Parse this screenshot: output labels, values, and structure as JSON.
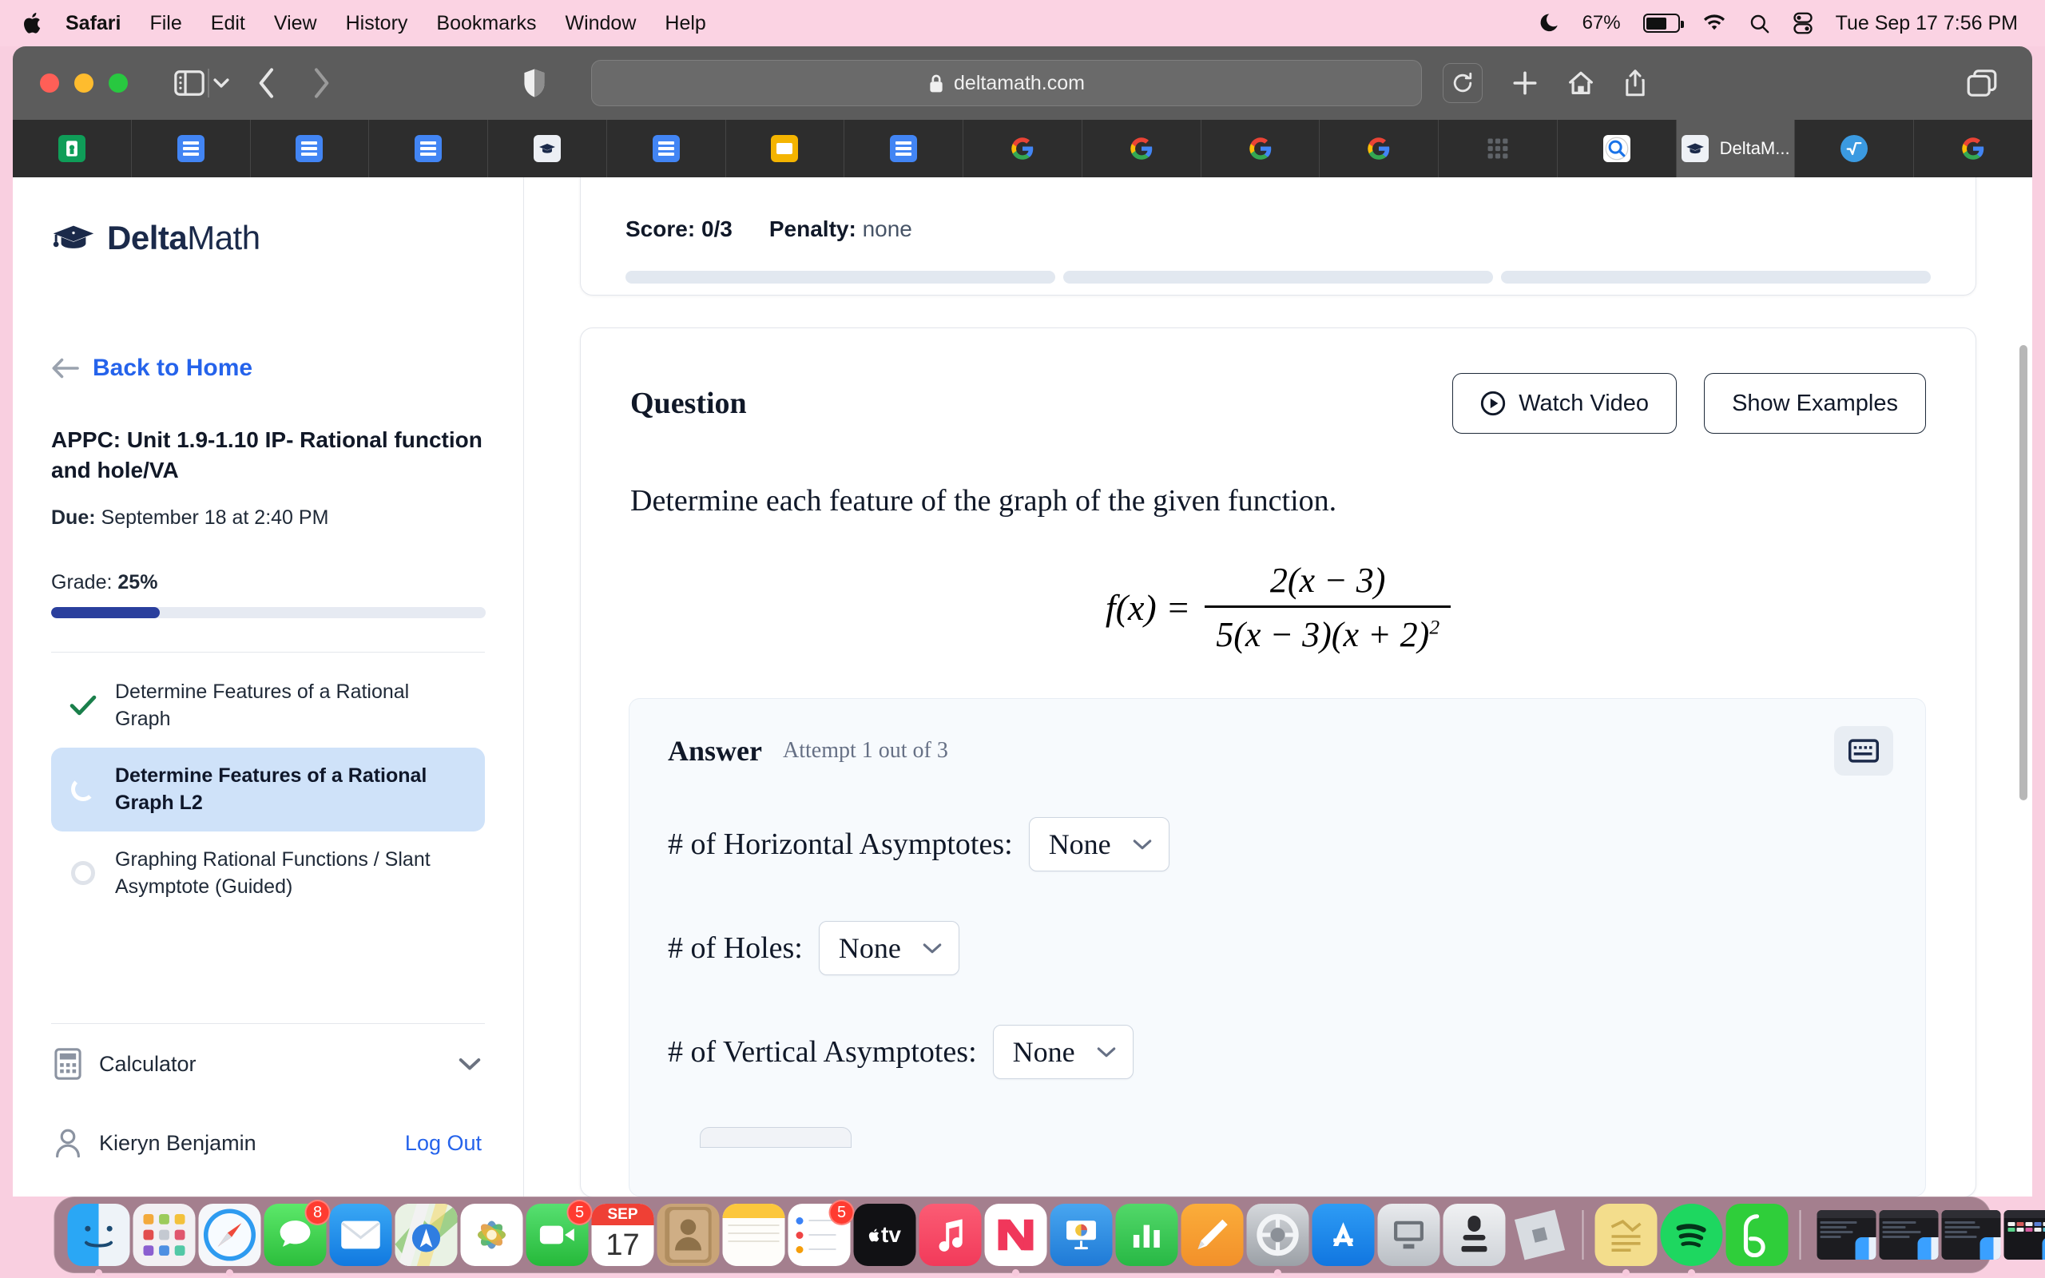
{
  "menubar": {
    "apple_icon": "apple-logo",
    "items": [
      {
        "label": "Safari",
        "bold": true
      },
      {
        "label": "File",
        "bold": false
      },
      {
        "label": "Edit",
        "bold": false
      },
      {
        "label": "View",
        "bold": false
      },
      {
        "label": "History",
        "bold": false
      },
      {
        "label": "Bookmarks",
        "bold": false
      },
      {
        "label": "Window",
        "bold": false
      },
      {
        "label": "Help",
        "bold": false
      }
    ],
    "status": {
      "focus_icon": "moon-icon",
      "battery_percent": "67%",
      "battery_level": 67,
      "wifi_icon": "wifi-icon",
      "search_icon": "search-icon",
      "control_center_icon": "control-center-icon",
      "datetime": "Tue Sep 17  7:56 PM"
    }
  },
  "browser": {
    "traffic_lights": [
      "close",
      "minimize",
      "zoom"
    ],
    "sidebar_icon": "sidebar-toggle-icon",
    "sidebar_chevron_icon": "chevron-down-icon",
    "back_icon": "chevron-left-icon",
    "forward_icon": "chevron-right-icon",
    "shield_icon": "privacy-shield-icon",
    "address": {
      "lock_icon": "lock-icon",
      "url": "deltamath.com"
    },
    "reload_icon": "reload-icon",
    "new_tab_icon": "plus-icon",
    "home_icon": "home-icon",
    "share_icon": "share-icon",
    "tab_overview_icon": "tab-overview-icon",
    "tabs": [
      {
        "favicon": "green-app-icon",
        "title": "",
        "active": false
      },
      {
        "favicon": "google-docs-icon",
        "title": "",
        "active": false
      },
      {
        "favicon": "google-docs-icon",
        "title": "",
        "active": false
      },
      {
        "favicon": "google-docs-icon",
        "title": "",
        "active": false
      },
      {
        "favicon": "deltamath-icon",
        "title": "",
        "active": false
      },
      {
        "favicon": "google-docs-icon",
        "title": "",
        "active": false
      },
      {
        "favicon": "google-slides-icon",
        "title": "",
        "active": false
      },
      {
        "favicon": "google-docs-icon",
        "title": "",
        "active": false
      },
      {
        "favicon": "google-icon",
        "title": "",
        "active": false
      },
      {
        "favicon": "google-icon",
        "title": "",
        "active": false
      },
      {
        "favicon": "google-icon",
        "title": "",
        "active": false
      },
      {
        "favicon": "google-icon",
        "title": "",
        "active": false
      },
      {
        "favicon": "google-apps-grid-icon",
        "title": "",
        "active": false
      },
      {
        "favicon": "search-circle-icon",
        "title": "",
        "active": false
      },
      {
        "favicon": "deltamath-icon",
        "title": "DeltaM...",
        "active": true
      },
      {
        "favicon": "radical-icon",
        "title": "",
        "active": false
      },
      {
        "favicon": "google-icon",
        "title": "",
        "active": false
      }
    ]
  },
  "sidebar": {
    "logo_text_bold": "Delta",
    "logo_text_light": "Math",
    "logo_icon": "graduation-cap-icon",
    "back_arrow_icon": "arrow-left-icon",
    "back_label": "Back to Home",
    "assignment_title": "APPC: Unit 1.9-1.10 IP- Rational function and hole/VA",
    "due_label": "Due:",
    "due_value": "September 18 at 2:40 PM",
    "grade_label": "Grade:",
    "grade_value": "25%",
    "grade_percent": 25,
    "problems": [
      {
        "label": "Determine Features of a Rational Graph",
        "status": "complete",
        "status_icon": "check-icon",
        "current": false
      },
      {
        "label": "Determine Features of a Rational Graph L2",
        "status": "in-progress",
        "status_icon": "partial-ring-icon",
        "current": true
      },
      {
        "label": "Graphing Rational Functions / Slant Asymptote (Guided)",
        "status": "not-started",
        "status_icon": "empty-ring-icon",
        "current": false
      }
    ],
    "calculator_label": "Calculator",
    "calculator_icon": "calculator-icon",
    "calculator_chevron_icon": "chevron-down-icon",
    "user_name": "Kieryn Benjamin",
    "user_icon": "person-icon",
    "logout_label": "Log Out"
  },
  "main": {
    "score_label": "Score:",
    "score_value": "0/3",
    "penalty_label": "Penalty:",
    "penalty_value": "none",
    "progress_segments": 3,
    "question_title": "Question",
    "watch_video_label": "Watch Video",
    "watch_video_icon": "play-circle-icon",
    "show_examples_label": "Show Examples",
    "prompt": "Determine each feature of the graph of the given function.",
    "formula": {
      "lhs": "f(x) =",
      "numerator": "2(x − 3)",
      "denominator_base": "5(x − 3)(x + 2)",
      "denominator_exp": "2"
    },
    "answer": {
      "title": "Answer",
      "attempt": "Attempt 1 out of 3",
      "keyboard_icon": "keyboard-icon",
      "fields": [
        {
          "label": "# of Horizontal Asymptotes:",
          "value": "None",
          "chevron_icon": "chevron-down-icon"
        },
        {
          "label": "# of Holes:",
          "value": "None",
          "chevron_icon": "chevron-down-icon"
        },
        {
          "label": "# of Vertical Asymptotes:",
          "value": "None",
          "chevron_icon": "chevron-down-icon"
        }
      ]
    }
  },
  "dock": {
    "items": [
      {
        "name": "finder",
        "running": true,
        "badge": ""
      },
      {
        "name": "launchpad",
        "running": false,
        "badge": ""
      },
      {
        "name": "safari",
        "running": true,
        "badge": ""
      },
      {
        "name": "messages",
        "running": false,
        "badge": "8"
      },
      {
        "name": "mail",
        "running": false,
        "badge": ""
      },
      {
        "name": "maps",
        "running": false,
        "badge": ""
      },
      {
        "name": "photos",
        "running": false,
        "badge": ""
      },
      {
        "name": "facetime",
        "running": false,
        "badge": "5"
      },
      {
        "name": "calendar",
        "running": false,
        "badge": "",
        "month": "SEP",
        "day": "17"
      },
      {
        "name": "contacts",
        "running": false,
        "badge": ""
      },
      {
        "name": "notes",
        "running": false,
        "badge": ""
      },
      {
        "name": "reminders",
        "running": false,
        "badge": "5"
      },
      {
        "name": "apple-tv",
        "running": false,
        "badge": ""
      },
      {
        "name": "music",
        "running": false,
        "badge": ""
      },
      {
        "name": "news",
        "running": true,
        "badge": ""
      },
      {
        "name": "keynote",
        "running": false,
        "badge": ""
      },
      {
        "name": "numbers",
        "running": false,
        "badge": ""
      },
      {
        "name": "pages",
        "running": false,
        "badge": ""
      },
      {
        "name": "system-settings",
        "running": true,
        "badge": ""
      },
      {
        "name": "app-store",
        "running": false,
        "badge": ""
      },
      {
        "name": "screen-sharing",
        "running": false,
        "badge": ""
      },
      {
        "name": "garageband",
        "running": false,
        "badge": ""
      },
      {
        "name": "roblox",
        "running": false,
        "badge": ""
      }
    ],
    "items2": [
      {
        "name": "stickies",
        "running": true,
        "badge": ""
      },
      {
        "name": "spotify",
        "running": true,
        "badge": ""
      },
      {
        "name": "brainly",
        "running": false,
        "badge": ""
      }
    ],
    "minimized": [
      "window-1",
      "window-2",
      "window-3",
      "window-4",
      "window-5"
    ],
    "trash_icon": "trash-icon"
  }
}
